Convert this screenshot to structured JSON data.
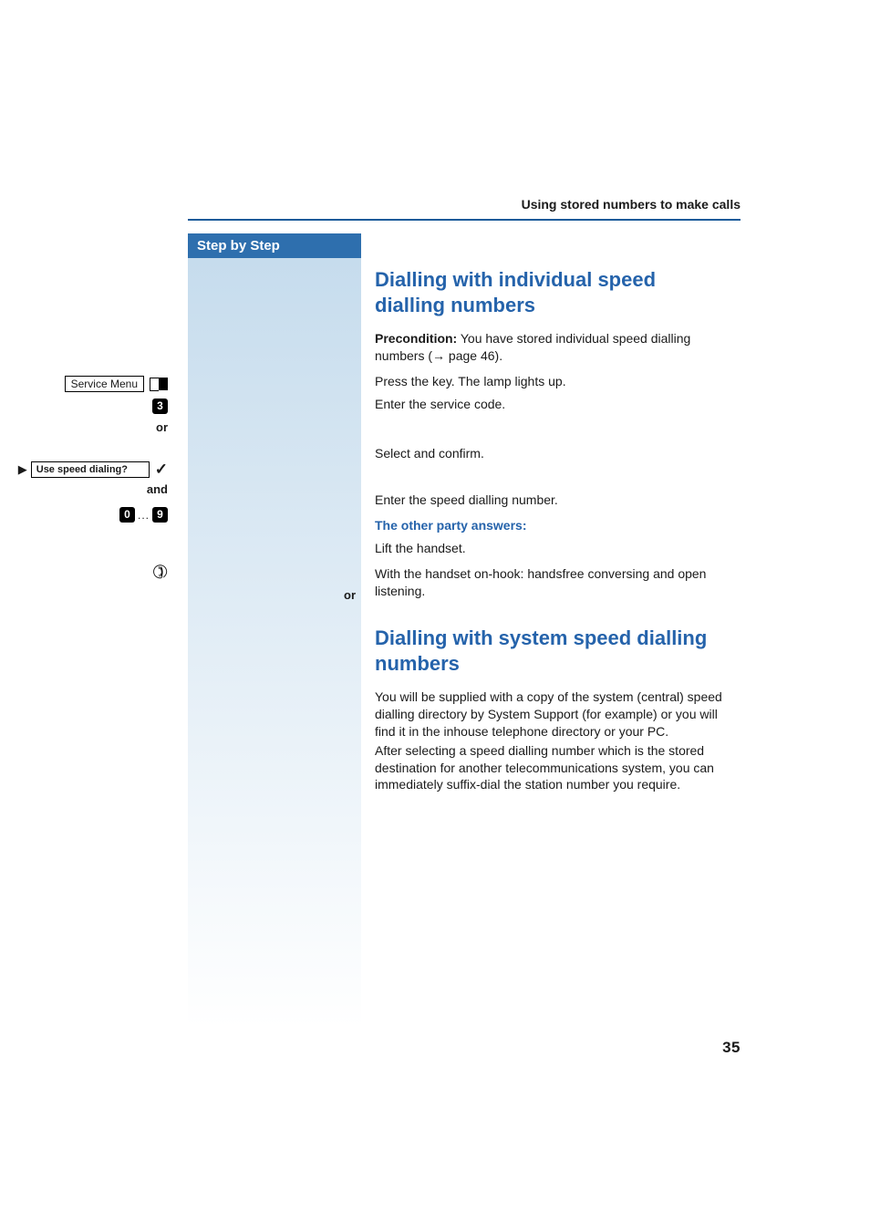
{
  "header": {
    "running_title": "Using stored numbers to make calls"
  },
  "sidebar": {
    "title": "Step by Step"
  },
  "steps": {
    "service_menu_label": "Service Menu",
    "key_3": "3",
    "or1": "or",
    "prompt_arrow": "▶",
    "prompt_label": "Use speed dialing?",
    "check": "✓",
    "and1": "and",
    "key_0": "0",
    "key_dots": "...",
    "key_9": "9",
    "or2": "or"
  },
  "section1": {
    "heading": "Dialling with individual speed dialling numbers",
    "precond_label": "Precondition:",
    "precond_text_a": " You have stored individual speed dialling numbers (",
    "precond_arrow": "→",
    "precond_text_b": " page 46).",
    "press_key": "Press the key. The lamp lights up.",
    "enter_code": "Enter the service code.",
    "select_confirm": "Select and confirm.",
    "enter_speed": "Enter the speed dialling number.",
    "sub_heading": "The other party answers:",
    "lift_handset": "Lift the handset.",
    "handsfree": "With the handset on-hook: handsfree conversing and open listening."
  },
  "section2": {
    "heading": "Dialling with system speed dialling numbers",
    "para1": "You will be supplied with a copy of the system (central) speed dialling directory by System Support (for example) or you will find it in the inhouse telephone directory or your PC.",
    "para2": "After selecting a speed dialling number which is the stored destination for another telecommunications system, you can immediately suffix-dial the station number you require."
  },
  "page_number": "35"
}
